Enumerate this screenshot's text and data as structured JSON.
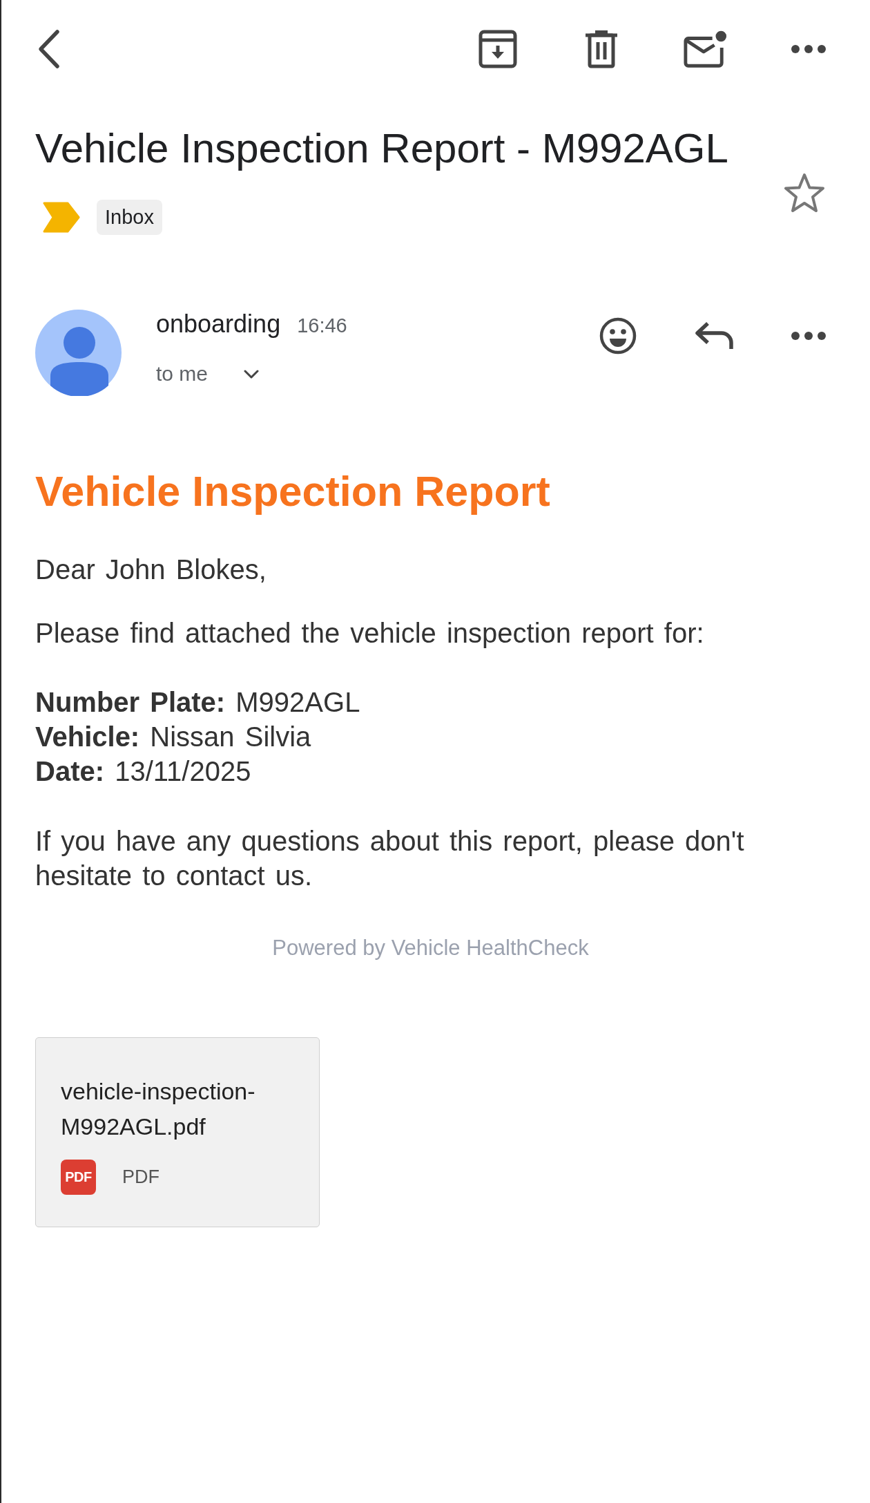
{
  "subject": "Vehicle Inspection Report - M992AGL",
  "starred": false,
  "labels": [
    {
      "text": "Inbox",
      "important": true
    }
  ],
  "message": {
    "sender": "onboarding",
    "time": "16:46",
    "recipient": "to me"
  },
  "body": {
    "heading": "Vehicle Inspection Report",
    "greeting": "Dear John Blokes,",
    "intro": "Please find attached the vehicle inspection report for:",
    "details": [
      "**Number Plate:** M992AGL",
      "**Vehicle:** Nissan Silvia",
      "**Date:** 13/11/2025"
    ],
    "closing": "If you have any questions about this report, please don't hesitate to contact us.",
    "footer": "Powered by Vehicle HealthCheck"
  },
  "attachments": [
    {
      "name": "vehicle-inspection-M992AGL.pdf",
      "kind": "pdf",
      "badge": "PDF",
      "type": "PDF"
    }
  ]
}
